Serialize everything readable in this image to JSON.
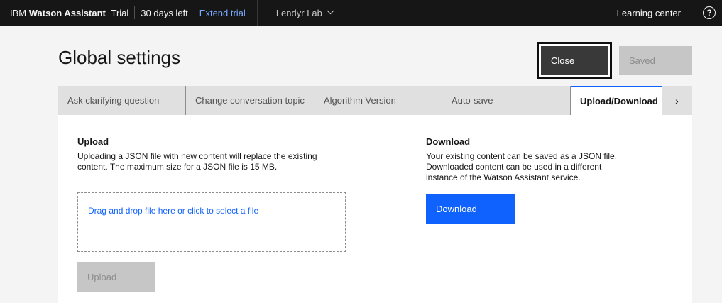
{
  "header": {
    "brand_ibm": "IBM",
    "brand_product": "Watson Assistant",
    "plan": "Trial",
    "days_left": "30 days left",
    "extend_trial": "Extend trial",
    "workspace": "Lendyr Lab",
    "learning_center": "Learning center",
    "help_symbol": "?"
  },
  "page": {
    "title": "Global settings",
    "close_label": "Close",
    "saved_label": "Saved"
  },
  "tabs": [
    {
      "label": "Ask clarifying question",
      "active": false
    },
    {
      "label": "Change conversation topic",
      "active": false
    },
    {
      "label": "Algorithm Version",
      "active": false
    },
    {
      "label": "Auto-save",
      "active": false
    },
    {
      "label": "Upload/Download",
      "active": true
    }
  ],
  "tabs_next_symbol": "›",
  "upload": {
    "title": "Upload",
    "description_line1": "Uploading a JSON file with new content will replace the existing",
    "description_line2": "content. The maximum size for a JSON file is 15 MB.",
    "dropzone_text": "Drag and drop file here or click to select a file",
    "button_label": "Upload"
  },
  "download": {
    "title": "Download",
    "description_line1": "Your existing content can be saved as a JSON file.",
    "description_line2": "Downloaded content can be used in a different",
    "description_line3": "instance of the Watson Assistant service.",
    "button_label": "Download"
  },
  "colors": {
    "header_bg": "#161616",
    "accent": "#0f62fe",
    "link": "#78a9ff",
    "page_bg": "#f4f4f4",
    "disabled_bg": "#c6c6c6"
  },
  "icons": {
    "workspace_dropdown": "chevron-down-icon",
    "help": "help-icon",
    "tabs_next": "chevron-right-icon"
  }
}
